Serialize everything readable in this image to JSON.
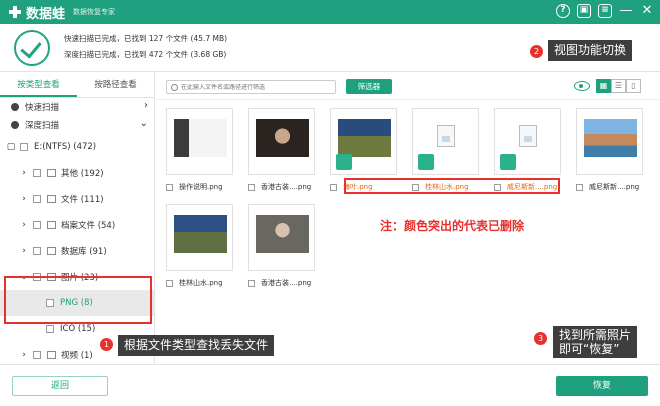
{
  "app": {
    "name": "数据蛙",
    "subtitle": "数据恢复专家"
  },
  "titlebar_icons": [
    "help-icon",
    "save-icon",
    "menu-icon",
    "minimize-icon",
    "close-icon"
  ],
  "titlebar_glyphs": {
    "help": "?",
    "save": "▣",
    "menu": "≡",
    "minimize": "—",
    "close": "✕"
  },
  "scan": {
    "quick": "快速扫描已完成，已找到 127 个文件 (45.7 MB)",
    "deep": "深度扫描已完成，已找到 472 个文件 (3.68 GB)"
  },
  "sidebar": {
    "tabs": [
      "按类型查看",
      "按路径查看"
    ],
    "modes": [
      "快速扫描",
      "深度扫描"
    ],
    "tree": [
      {
        "label": "E:(NTFS) (472)",
        "chev": "▢",
        "level": 0
      },
      {
        "label": "其他 (192)",
        "chev": "›",
        "level": 1
      },
      {
        "label": "文件 (111)",
        "chev": "›",
        "level": 1
      },
      {
        "label": "档案文件 (54)",
        "chev": "›",
        "level": 1
      },
      {
        "label": "数据库 (91)",
        "chev": "›",
        "level": 1
      },
      {
        "label": "图片 (23)",
        "chev": "⌄",
        "level": 1
      },
      {
        "label": "PNG (8)",
        "chev": "",
        "level": 2
      },
      {
        "label": "ICO (15)",
        "chev": "",
        "level": 2
      },
      {
        "label": "视频 (1)",
        "chev": "›",
        "level": 1
      }
    ]
  },
  "toolbar": {
    "search_placeholder": "在此输入文件名或路径进行筛选",
    "filter_label": "筛选器"
  },
  "files": [
    {
      "name": "操作说明.png",
      "deleted": false,
      "type": "screenshot"
    },
    {
      "name": "香港古装....png",
      "deleted": false,
      "type": "portrait"
    },
    {
      "name": "海叶.png",
      "deleted": true,
      "type": "landscape"
    },
    {
      "name": "桂林山水.png",
      "deleted": true,
      "type": "doc"
    },
    {
      "name": "威尼斯新....png",
      "deleted": true,
      "type": "doc"
    },
    {
      "name": "威尼斯新....png",
      "deleted": false,
      "type": "venice"
    },
    {
      "name": "桂林山水.png",
      "deleted": false,
      "type": "landscape2"
    },
    {
      "name": "香港古装....png",
      "deleted": false,
      "type": "portrait2"
    }
  ],
  "annotations": {
    "a1": {
      "num": "1",
      "text": "根据文件类型查找丢失文件"
    },
    "a2": {
      "num": "2",
      "text": "视图功能切换"
    },
    "a3": {
      "num": "3",
      "text": "找到所需照片",
      "text2": "即可“恢复”"
    },
    "note": "注：颜色突出的代表已删除"
  },
  "bottom": {
    "back_label": "返回",
    "restore_label": "恢复"
  },
  "colors": {
    "accent": "#1fa07e",
    "highlight": "#e8302c",
    "deleted": "#e36a1a"
  }
}
